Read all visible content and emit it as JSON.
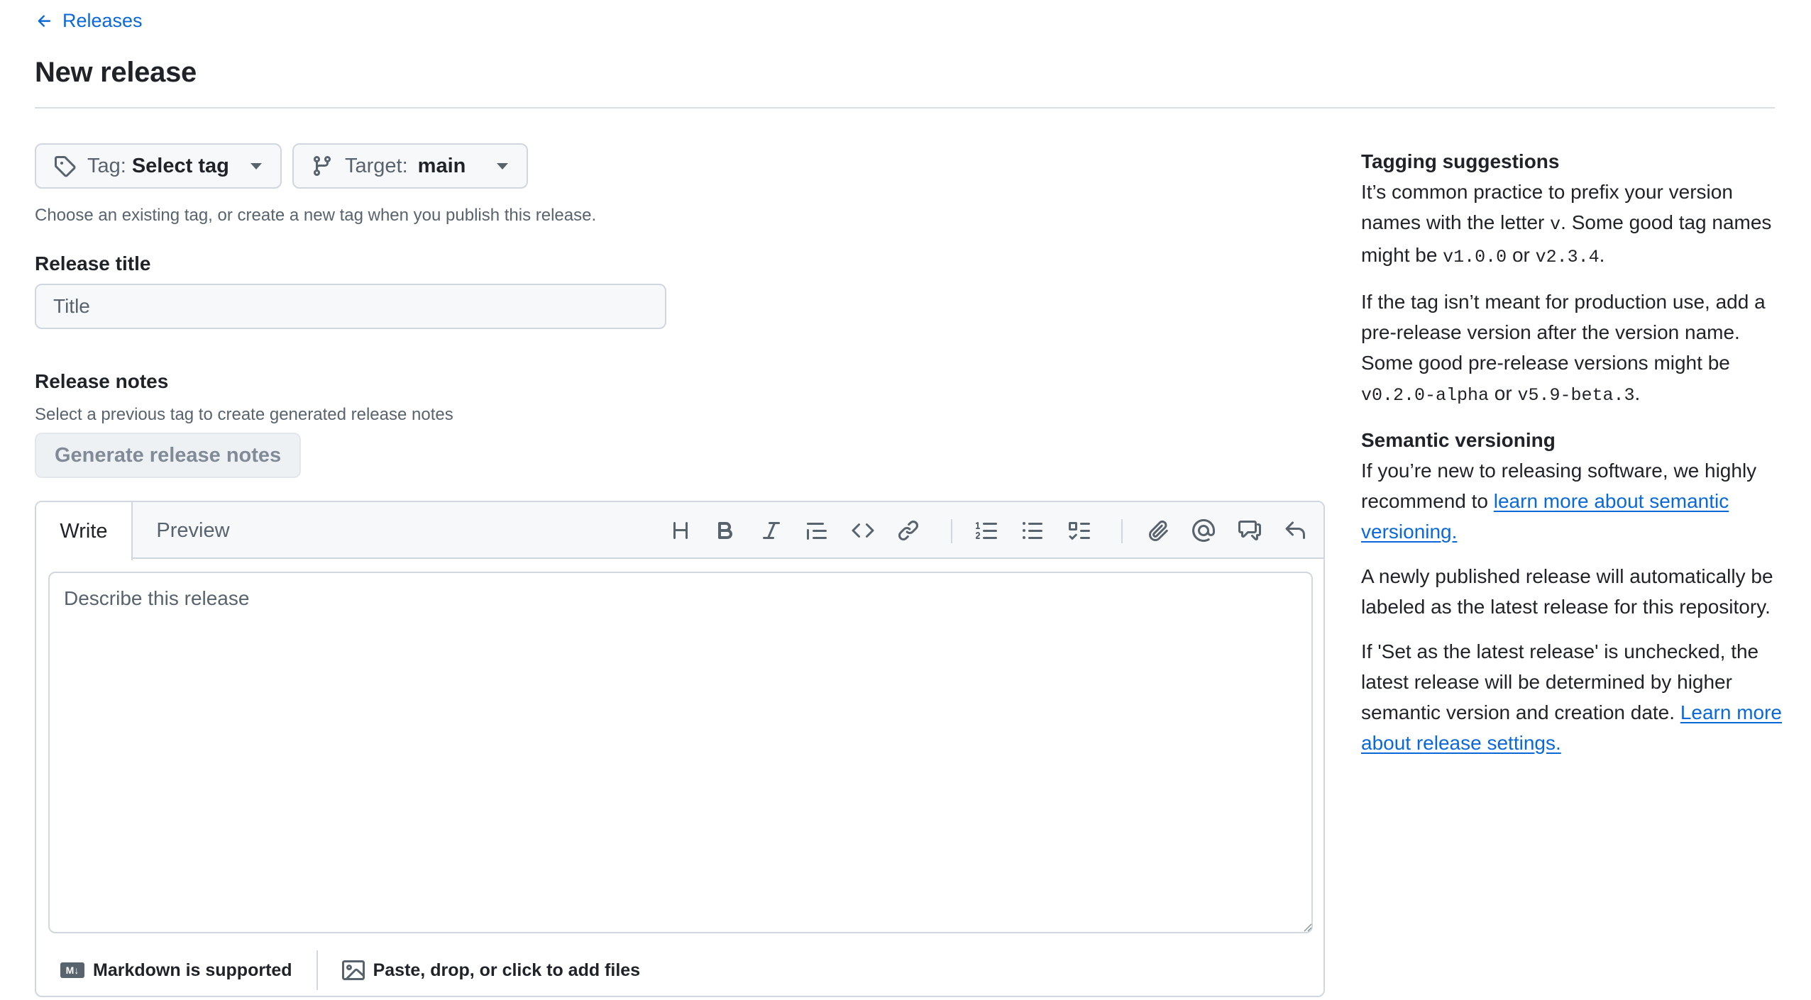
{
  "header": {
    "back_label": "Releases",
    "title": "New release"
  },
  "tag_selector": {
    "prefix": "Tag:",
    "value": "Select tag"
  },
  "target_selector": {
    "prefix": "Target:",
    "value": "main"
  },
  "tag_hint": "Choose an existing tag, or create a new tag when you publish this release.",
  "release_title": {
    "label": "Release title",
    "placeholder": "Title",
    "value": ""
  },
  "release_notes": {
    "label": "Release notes",
    "hint": "Select a previous tag to create generated release notes",
    "generate_label": "Generate release notes"
  },
  "editor": {
    "tabs": [
      {
        "label": "Write",
        "active": true
      },
      {
        "label": "Preview",
        "active": false
      }
    ],
    "toolbar": [
      "heading-icon",
      "bold-icon",
      "italic-icon",
      "quote-icon",
      "code-icon",
      "link-icon",
      "ordered-list-icon",
      "unordered-list-icon",
      "task-list-icon",
      "attach-icon",
      "mention-icon",
      "cross-reference-icon",
      "undo-icon"
    ],
    "placeholder": "Describe this release",
    "value": "",
    "footer": {
      "markdown_label": "Markdown is supported",
      "markdown_badge": "M↓",
      "files_label": "Paste, drop, or click to add files"
    }
  },
  "sidebar": {
    "tagging_heading": "Tagging suggestions",
    "tagging_p1_a": "It’s common practice to prefix your version names with the letter ",
    "tagging_p1_code1": "v",
    "tagging_p1_b": ". Some good tag names might be ",
    "tagging_p1_code2": "v1.0.0",
    "tagging_p1_c": " or ",
    "tagging_p1_code3": "v2.3.4",
    "tagging_p1_d": ".",
    "tagging_p2_a": "If the tag isn’t meant for production use, add a pre-release version after the version name. Some good pre-release versions might be ",
    "tagging_p2_code1": "v0.2.0-alpha",
    "tagging_p2_b": " or ",
    "tagging_p2_code2": "v5.9-beta.3",
    "tagging_p2_c": ".",
    "semver_heading": "Semantic versioning",
    "semver_p1_a": "If you’re new to releasing software, we highly recommend to ",
    "semver_p1_link": "learn more about semantic versioning.",
    "semver_p2": "A newly published release will automatically be labeled as the latest release for this repository.",
    "semver_p3_a": "If 'Set as the latest release' is unchecked, the latest release will be determined by higher semantic version and creation date. ",
    "semver_p3_link": "Learn more about release settings."
  },
  "colors": {
    "link": "#0969da",
    "border": "#d0d7de",
    "muted_text": "#59636e",
    "button_bg": "#f6f8fa"
  }
}
